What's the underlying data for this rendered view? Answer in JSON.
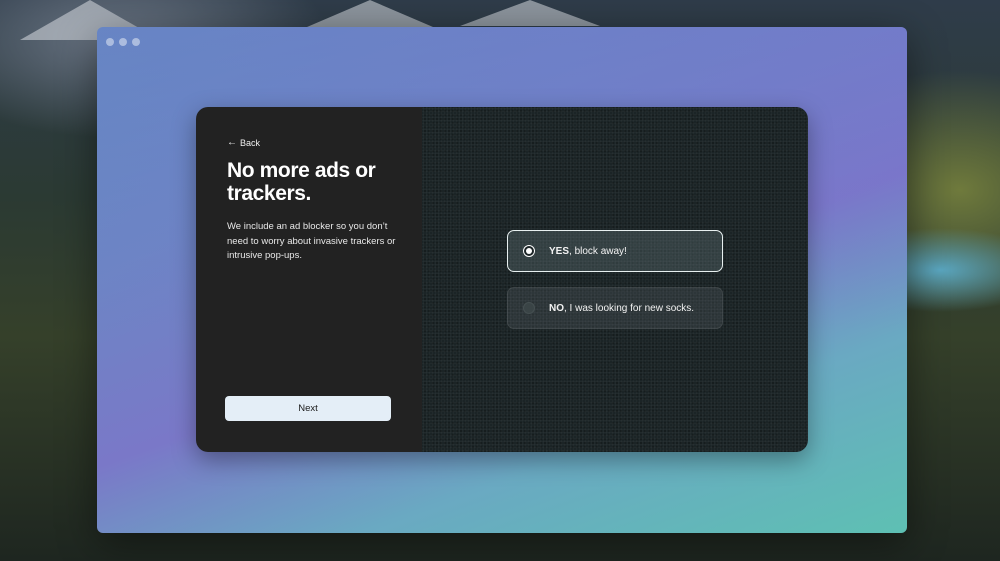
{
  "onboarding": {
    "back_label": "Back",
    "title": "No more ads or trackers.",
    "description": "We include an ad blocker so you don’t need to worry about invasive trackers or intrusive pop-ups.",
    "next_label": "Next",
    "options": [
      {
        "bold": "YES",
        "rest": ", block away!",
        "selected": true
      },
      {
        "bold": "NO",
        "rest": ", I was looking for new socks.",
        "selected": false
      }
    ]
  },
  "icons": {
    "back": "arrow-left-icon",
    "selected_radio": "radio-selected-icon",
    "unselected_radio": "radio-unselected-icon"
  },
  "colors": {
    "left_panel": "#222222",
    "right_panel": "#1b2426",
    "next_button": "#e4eef7",
    "window_gradient_top": "#6c86c4",
    "window_gradient_bottom": "#5ec0b3"
  }
}
